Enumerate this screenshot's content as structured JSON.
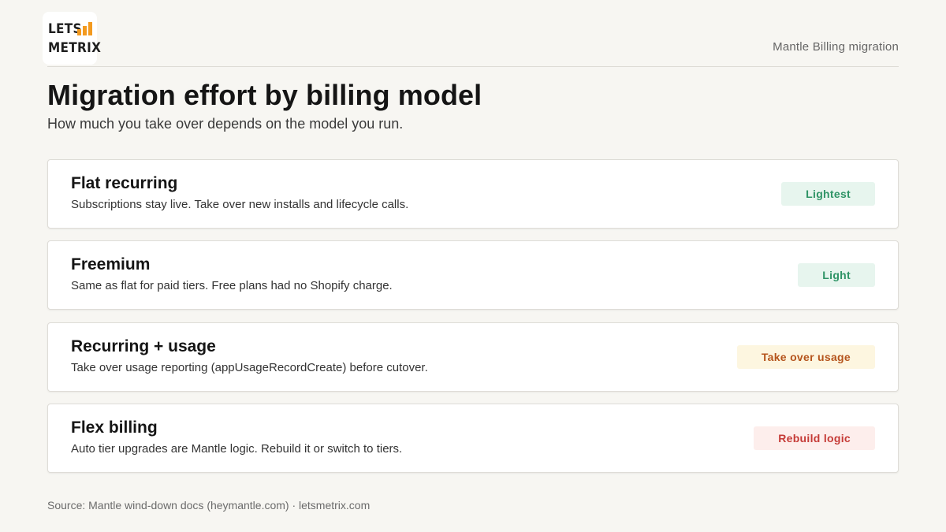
{
  "logo": {
    "line1": "LETS",
    "line2": "METRIX",
    "bar_color": "#f39a1f"
  },
  "header": {
    "context": "Mantle Billing migration"
  },
  "title": "Migration effort by billing model",
  "subtitle": "How much you take over depends on the model you run.",
  "cards": [
    {
      "title": "Flat recurring",
      "description": "Subscriptions stay live. Take over new installs and lifecycle calls.",
      "badge": "Lightest",
      "badge_bg": "#e7f5ee",
      "badge_color": "#2f9466"
    },
    {
      "title": "Freemium",
      "description": "Same as flat for paid tiers. Free plans had no Shopify charge.",
      "badge": "Light",
      "badge_bg": "#e7f5ee",
      "badge_color": "#2f9466"
    },
    {
      "title": "Recurring + usage",
      "description": "Take over usage reporting (appUsageRecordCreate) before cutover.",
      "badge": "Take over usage",
      "badge_bg": "#fdf6e0",
      "badge_color": "#b5541c"
    },
    {
      "title": "Flex billing",
      "description": "Auto tier upgrades are Mantle logic. Rebuild it or switch to tiers.",
      "badge": "Rebuild logic",
      "badge_bg": "#fdeeec",
      "badge_color": "#c53a36"
    }
  ],
  "footer": "Source: Mantle wind-down docs (heymantle.com) · letsmetrix.com"
}
